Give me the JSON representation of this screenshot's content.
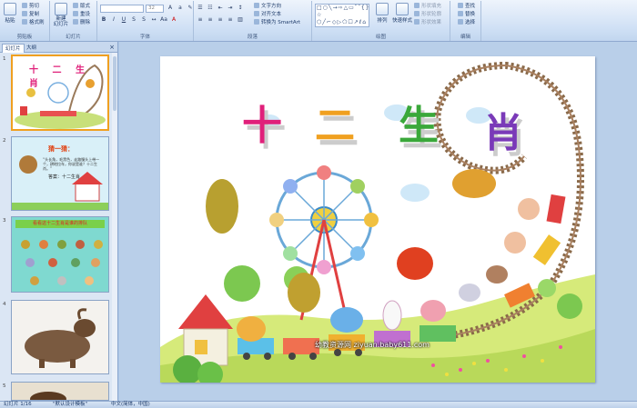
{
  "ribbon": {
    "groups": [
      {
        "label": "剪贴板"
      },
      {
        "label": "幻灯片"
      },
      {
        "label": "字体"
      },
      {
        "label": "段落"
      },
      {
        "label": "绘图"
      },
      {
        "label": "编辑"
      }
    ],
    "clipboard": {
      "paste": "粘贴",
      "cut": "剪切",
      "copy": "复制",
      "format_painter": "格式刷"
    },
    "slides": {
      "new_slide": "新建\n幻灯片",
      "layout": "版式",
      "reset": "重设",
      "delete": "删除"
    },
    "font": {
      "font_name": "",
      "font_size": "32"
    },
    "paragraph": {
      "text_direction": "文字方向",
      "align_text": "对齐文本",
      "smartart": "转换为 SmartArt"
    },
    "drawing": {
      "arrange": "排列",
      "quick_styles": "快速样式",
      "shape_fill": "形状填充",
      "shape_outline": "形状轮廓",
      "shape_effects": "形状效果"
    },
    "editing": {
      "find": "查找",
      "replace": "替换",
      "select": "选择"
    }
  },
  "left_pane": {
    "tabs": [
      "幻灯片",
      "大纲"
    ],
    "close": "×",
    "slide_numbers": [
      "1",
      "2",
      "3",
      "4",
      "5"
    ],
    "thumb1": {
      "title": "十 二 生 肖"
    },
    "thumb2": {
      "heading": "猜一猜：",
      "riddle": "“头长角，毛黑色，走路慢头上带一个，耕地拉车，你说是谁？十二生肖。”",
      "answer": "答案：十二生肖"
    },
    "thumb3": {
      "banner": "看看这十二生肖是谁的排队"
    }
  },
  "slide": {
    "title_chars": [
      "十",
      "二",
      "生",
      "肖"
    ],
    "title_colors": [
      "#e0207a",
      "#f0a020",
      "#3aa83a",
      "#7a3ab8"
    ],
    "watermark": "幼教资源网 ziyuan.baby611.com"
  },
  "status": {
    "slide_info": "幻灯片 1/16",
    "theme": "\"默认设计模板\"",
    "language": "中文(简体，中国)"
  }
}
